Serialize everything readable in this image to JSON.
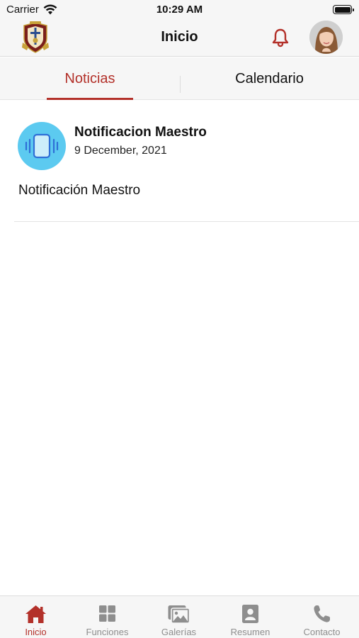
{
  "status": {
    "carrier": "Carrier",
    "time": "10:29 AM"
  },
  "header": {
    "title": "Inicio"
  },
  "tabs": [
    {
      "label": "Noticias",
      "active": true
    },
    {
      "label": "Calendario",
      "active": false
    }
  ],
  "news": [
    {
      "title": "Notificacion Maestro",
      "date": "9 December, 2021",
      "body": "Notificación Maestro",
      "icon": "vibrating-phone-icon"
    }
  ],
  "tabbar": {
    "items": [
      {
        "label": "Inicio",
        "icon": "home-icon",
        "active": true
      },
      {
        "label": "Funciones",
        "icon": "grid-icon",
        "active": false
      },
      {
        "label": "Galerías",
        "icon": "gallery-icon",
        "active": false
      },
      {
        "label": "Resumen",
        "icon": "profile-card-icon",
        "active": false
      },
      {
        "label": "Contacto",
        "icon": "phone-icon",
        "active": false
      }
    ]
  },
  "colors": {
    "accent": "#b3312a",
    "icon_bg": "#5ccaf0",
    "inactive": "#8e8e8e"
  }
}
